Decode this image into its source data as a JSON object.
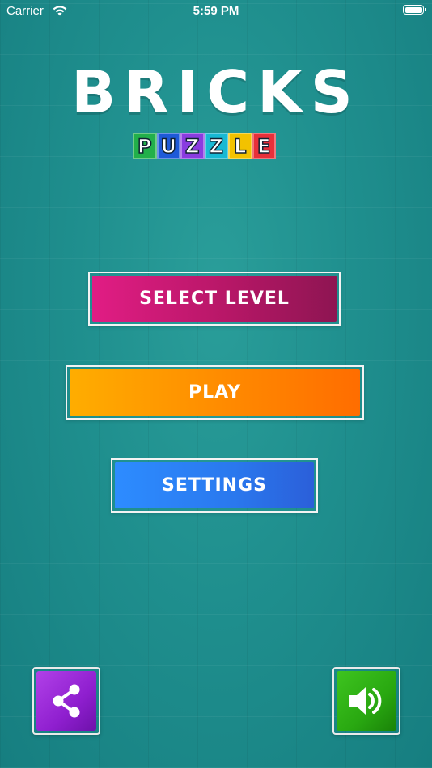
{
  "status_bar": {
    "carrier": "Carrier",
    "time": "5:59 PM"
  },
  "logo": {
    "title": "BRICKS",
    "subtitle_letters": [
      "P",
      "U",
      "Z",
      "Z",
      "L",
      "E"
    ],
    "subtitle_colors": [
      "#22b04a",
      "#1e5ad8",
      "#8a3ce0",
      "#18b9d4",
      "#f2c200",
      "#e8303a"
    ]
  },
  "menu": {
    "select_level": "SELECT LEVEL",
    "play": "PLAY",
    "settings": "SETTINGS"
  },
  "icons": {
    "share": "share-icon",
    "sound": "speaker-icon"
  }
}
